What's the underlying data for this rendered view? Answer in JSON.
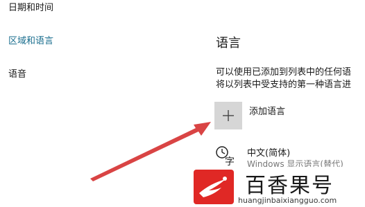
{
  "sidebar": {
    "items": [
      {
        "label": "日期和时间"
      },
      {
        "label": "区域和语言"
      },
      {
        "label": "语音"
      }
    ]
  },
  "main": {
    "section_title": "语言",
    "description_lines": [
      "可以使用已添加到列表中的任何语",
      "将以列表中受支持的第一种语言进"
    ],
    "add_language_label": "添加语言",
    "languages": [
      {
        "name": "中文(简体)",
        "sublabel": "Windows 显示语言(替代)"
      }
    ]
  },
  "icons": [
    "plus-icon",
    "language-icon",
    "arrow-annotation",
    "watermark-logo"
  ],
  "colors": {
    "accent": "#1a6e8e",
    "arrow": "#d94444",
    "add_tile": "#d6d6d6",
    "watermark_red": "#e0221e"
  },
  "watermark": {
    "title": "百香果号",
    "url": "huangjinbaixiangguo.com"
  }
}
